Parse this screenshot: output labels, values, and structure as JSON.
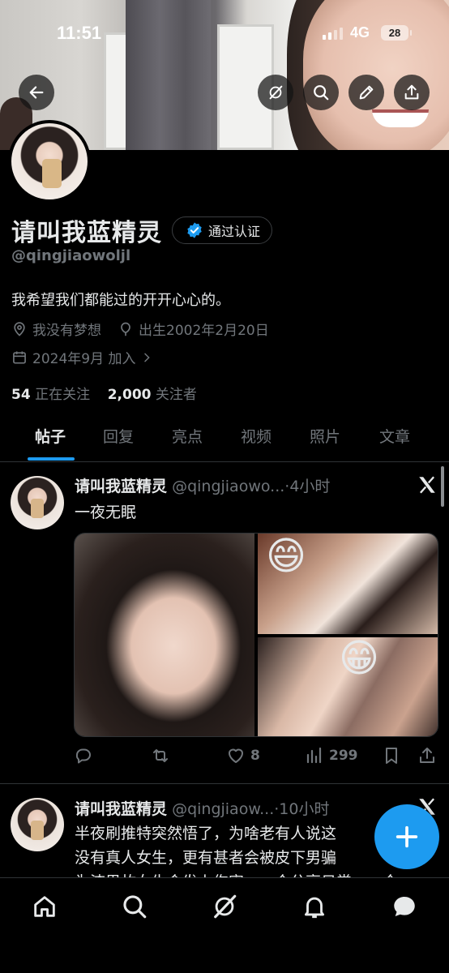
{
  "status_bar": {
    "time": "11:51",
    "network": "4G",
    "battery": "28"
  },
  "header": {
    "back_icon": "arrow-left-icon",
    "grok_icon": "grok-icon",
    "search_icon": "search-icon",
    "edit_icon": "pencil-icon",
    "share_icon": "share-icon"
  },
  "profile": {
    "name": "请叫我蓝精灵",
    "verified_label": "通过认证",
    "handle": "@qingjiaowoljl",
    "bio": "我希望我们都能过的开开心心的。",
    "location": "我没有梦想",
    "birth": "出生2002年2月20日",
    "joined": "2024年9月 加入",
    "following_count": "54",
    "following_label": "正在关注",
    "followers_count": "2,000",
    "followers_label": "关注者"
  },
  "tabs": [
    {
      "label": "帖子",
      "active": true
    },
    {
      "label": "回复",
      "active": false
    },
    {
      "label": "亮点",
      "active": false
    },
    {
      "label": "视频",
      "active": false
    },
    {
      "label": "照片",
      "active": false
    },
    {
      "label": "文章",
      "active": false
    }
  ],
  "posts": [
    {
      "name": "请叫我蓝精灵",
      "handle": "@qingjiaowo...",
      "time": "·4小时",
      "text": "一夜无眠",
      "emoji_1": "😄",
      "emoji_2": "😁",
      "replies": "",
      "reposts": "",
      "likes": "8",
      "views": "299"
    },
    {
      "name": "请叫我蓝精灵",
      "handle": "@qingjiaow...",
      "time": "·10小时",
      "text_line_1": "半夜刷推特突然悟了，为啥老有人说这",
      "text_line_2": "没有真人女生，更有甚者会被皮下男骗",
      "text_line_3": "为渣男故女生会发上伤害，一个分享日常，一个"
    }
  ],
  "colors": {
    "accent": "#1d9bf0",
    "background": "#000000",
    "muted": "#71767b",
    "text": "#e7e9ea"
  },
  "bottom_nav": [
    "home-icon",
    "search-icon",
    "grok-icon",
    "bell-icon",
    "messages-icon"
  ],
  "fab_icon": "plus-icon"
}
